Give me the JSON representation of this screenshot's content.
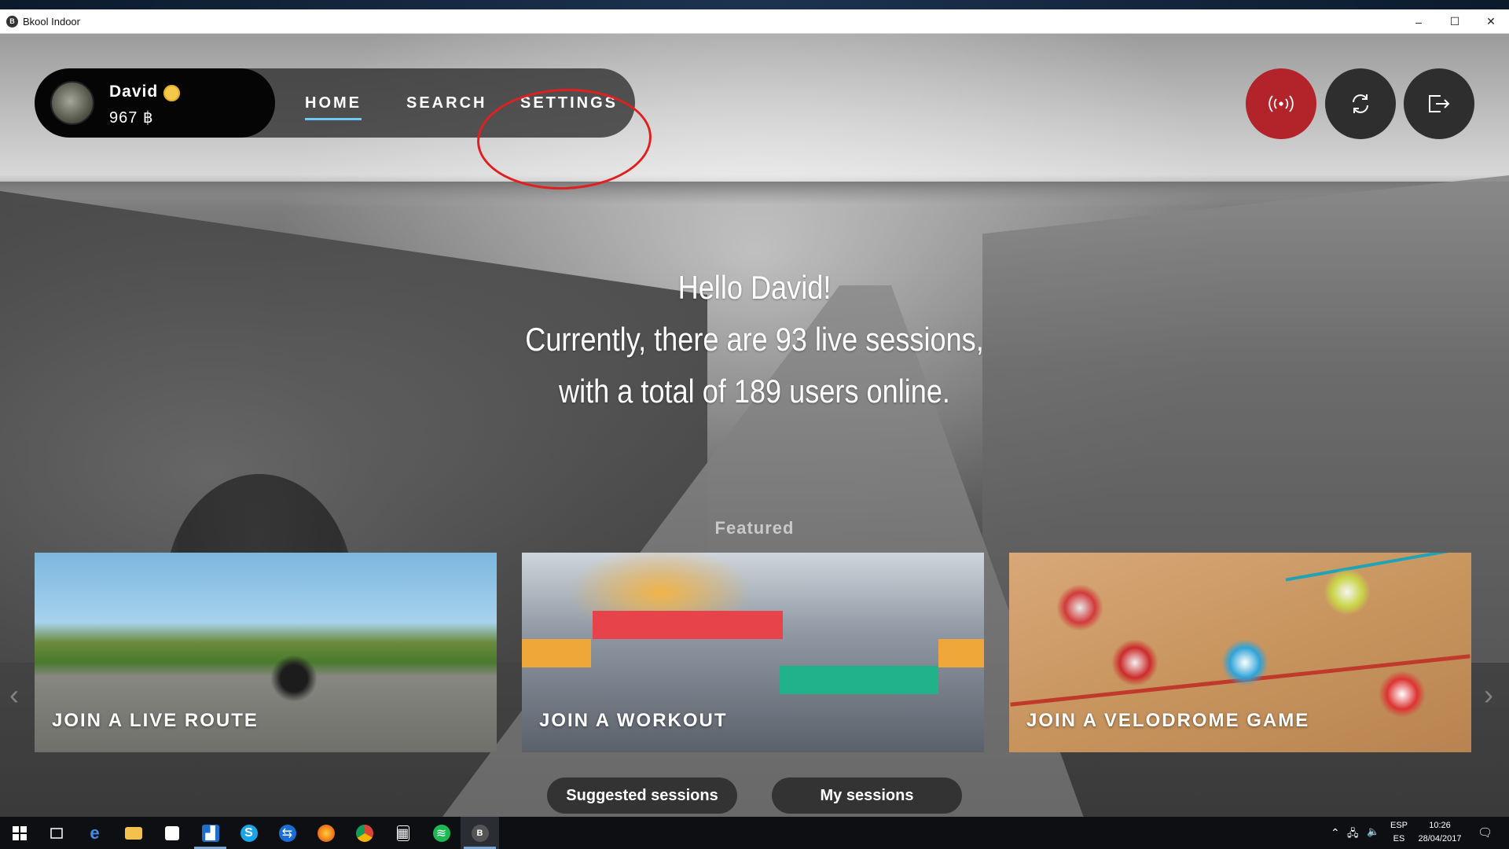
{
  "window": {
    "title": "Bkool Indoor",
    "app_icon_letter": "B",
    "controls": {
      "minimize": "–",
      "maximize": "☐",
      "close": "✕"
    }
  },
  "user": {
    "name": "David",
    "balance": "967 ฿",
    "avatar_icon": "avatar-icon",
    "coin_icon": "coin-icon"
  },
  "nav": {
    "items": [
      {
        "label": "HOME",
        "active": true
      },
      {
        "label": "SEARCH",
        "active": false
      },
      {
        "label": "SETTINGS",
        "active": false
      }
    ],
    "highlight_color": "#e02020",
    "active_underline_color": "#6ec8ff"
  },
  "actions": {
    "live_icon": "broadcast-icon",
    "live_color": "#b3232a",
    "sync_icon": "sync-icon",
    "logout_icon": "logout-icon"
  },
  "hero": {
    "line1": "Hello David!",
    "line2": "Currently, there are 93 live sessions,",
    "line3": "with a total of 189 users online."
  },
  "featured": {
    "label": "Featured",
    "cards": [
      {
        "title": "JOIN A LIVE ROUTE"
      },
      {
        "title": "JOIN A WORKOUT"
      },
      {
        "title": "JOIN A VELODROME GAME"
      }
    ],
    "prev_icon": "chevron-left-icon",
    "next_icon": "chevron-right-icon"
  },
  "tabs": {
    "suggested": "Suggested sessions",
    "my": "My sessions"
  },
  "taskbar": {
    "icons": [
      "windows-start-icon",
      "task-view-icon",
      "edge-icon",
      "file-explorer-icon",
      "store-icon",
      "chart-app-icon",
      "skype-icon",
      "teamviewer-icon",
      "firefox-icon",
      "chrome-icon",
      "calculator-icon",
      "spotify-icon",
      "bkool-icon"
    ],
    "bkool_letter": "B",
    "tray": {
      "lang_line1": "ESP",
      "lang_line2": "ES",
      "time": "10:26",
      "date": "28/04/2017"
    }
  }
}
